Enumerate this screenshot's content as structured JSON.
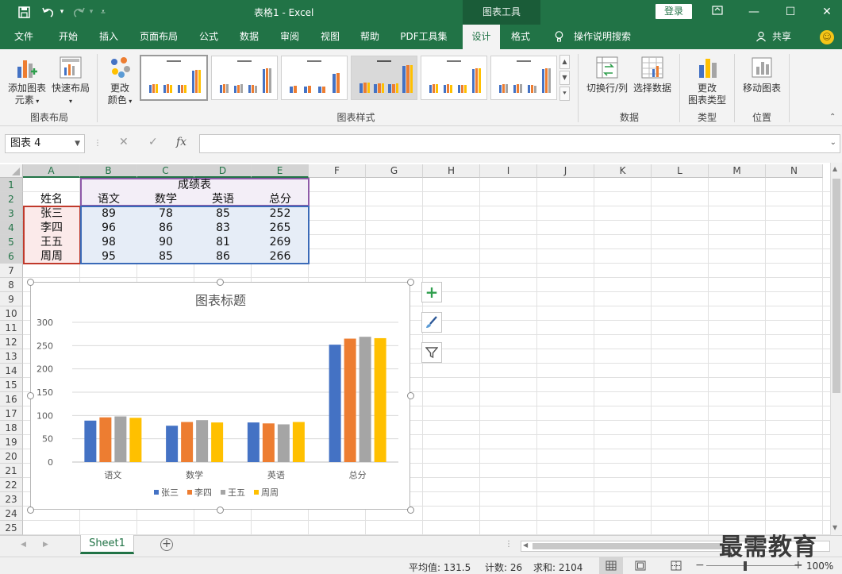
{
  "titlebar": {
    "title": "表格1 - Excel",
    "context_tools": "图表工具",
    "login": "登录",
    "qa_save_icon": "save-icon",
    "qa_undo_icon": "undo-icon",
    "qa_redo_icon": "redo-icon"
  },
  "tabs": [
    "文件",
    "开始",
    "插入",
    "页面布局",
    "公式",
    "数据",
    "审阅",
    "视图",
    "帮助",
    "PDF工具集",
    "设计",
    "格式"
  ],
  "active_tab": "设计",
  "tell_me": "操作说明搜索",
  "share": "共享",
  "ribbon": {
    "add_element": "添加图表\n元素",
    "add_element_line1": "添加图表",
    "add_element_line2": "元素",
    "quick_layout": "快速布局",
    "change_color_line1": "更改",
    "change_color_line2": "颜色",
    "group_layout": "图表布局",
    "group_styles": "图表样式",
    "switch_row_col": "切换行/列",
    "select_data": "选择数据",
    "group_data": "数据",
    "change_type_line1": "更改",
    "change_type_line2": "图表类型",
    "group_type": "类型",
    "move_chart": "移动图表",
    "group_location": "位置"
  },
  "formula": {
    "name_box": "图表 4",
    "fx": "fx",
    "value": ""
  },
  "columns": [
    "A",
    "B",
    "C",
    "D",
    "E",
    "F",
    "G",
    "H",
    "I",
    "J",
    "K",
    "L",
    "M",
    "N"
  ],
  "rows": [
    "1",
    "2",
    "3",
    "4",
    "5",
    "6",
    "7",
    "8",
    "9",
    "10",
    "11",
    "12",
    "13",
    "14",
    "15",
    "16",
    "17",
    "18",
    "19",
    "20",
    "21",
    "22",
    "23",
    "24",
    "25"
  ],
  "sheet": {
    "title": "成绩表",
    "headers": [
      "姓名",
      "语文",
      "数学",
      "英语",
      "总分"
    ],
    "data": [
      [
        "张三",
        "89",
        "78",
        "85",
        "252"
      ],
      [
        "李四",
        "96",
        "86",
        "83",
        "265"
      ],
      [
        "王五",
        "98",
        "90",
        "81",
        "269"
      ],
      [
        "周周",
        "95",
        "85",
        "86",
        "266"
      ]
    ]
  },
  "chart_data": {
    "type": "bar",
    "title": "图表标题",
    "categories": [
      "语文",
      "数学",
      "英语",
      "总分"
    ],
    "series": [
      {
        "name": "张三",
        "values": [
          89,
          78,
          85,
          252
        ],
        "color": "#4472c4"
      },
      {
        "name": "李四",
        "values": [
          96,
          86,
          83,
          265
        ],
        "color": "#ed7d31"
      },
      {
        "name": "王五",
        "values": [
          98,
          90,
          81,
          269
        ],
        "color": "#a5a5a5"
      },
      {
        "name": "周周",
        "values": [
          95,
          85,
          86,
          266
        ],
        "color": "#ffc000"
      }
    ],
    "yticks": [
      0,
      50,
      100,
      150,
      200,
      250,
      300
    ],
    "ylim": [
      0,
      300
    ],
    "grid": true,
    "legend": "bottom"
  },
  "sheet_tab": "Sheet1",
  "status": {
    "average": "平均值: 131.5",
    "count": "计数: 26",
    "sum": "求和: 2104",
    "zoom": "100%"
  },
  "watermark": "最需教育",
  "colors": {
    "excel_green": "#217346",
    "ribbon_bg": "#f3f3f3"
  }
}
